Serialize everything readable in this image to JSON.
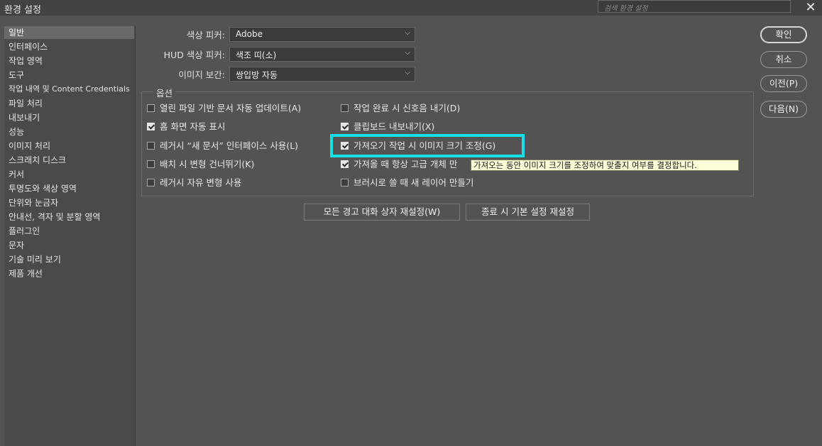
{
  "window": {
    "title": "환경 설정",
    "search_placeholder": "검색 환경 설정"
  },
  "sidebar": {
    "items": [
      "일반",
      "인터페이스",
      "작업 영역",
      "도구",
      "작업 내역 및 Content Credentials",
      "파일 처리",
      "내보내기",
      "성능",
      "이미지 처리",
      "스크래치 디스크",
      "커서",
      "투명도와 색상 영역",
      "단위와 눈금자",
      "안내선, 격자 및 분할 영역",
      "플러그인",
      "문자",
      "기술 미리 보기",
      "제품 개선"
    ]
  },
  "fields": {
    "color_picker": {
      "label": "색상 피커:",
      "value": "Adobe"
    },
    "hud_picker": {
      "label": "HUD 색상 피커:",
      "value": "색조 띠(소)"
    },
    "interpolation": {
      "label": "이미지 보간:",
      "value": "쌍입방 자동"
    }
  },
  "options": {
    "legend": "옵션",
    "items": [
      {
        "label": "열린 파일 기반 문서 자동 업데이트(A)",
        "checked": false
      },
      {
        "label": "작업 완료 시 신호음 내기(D)",
        "checked": false
      },
      {
        "label": "홈 화면 자동 표시",
        "checked": true
      },
      {
        "label": "클립보드 내보내기(X)",
        "checked": true
      },
      {
        "label": "레거시 “새 문서” 인터페이스 사용(L)",
        "checked": false
      },
      {
        "label": "가져오기 작업 시 이미지 크기 조정(G)",
        "checked": true
      },
      {
        "label": "배치 시 변형 건너뛰기(K)",
        "checked": false
      },
      {
        "label": "가져올 때 항상 고급 개체 만",
        "checked": true
      },
      {
        "label": "레거시 자유 변형 사용",
        "checked": false
      },
      {
        "label": "브러시로 쓸 때 새 레이어 만들기",
        "checked": false
      }
    ]
  },
  "tooltip": "가져오는 동안 이미지 크기를 조정하여 맞출지 여부를 결정합니다.",
  "buttons": {
    "reset_warnings": "모든 경고 대화 상자 재설정(W)",
    "reset_on_quit": "종료 시 기본 설정 재설정",
    "ok": "확인",
    "cancel": "취소",
    "prev": "이전(P)",
    "next": "다음(N)"
  },
  "colors": {
    "highlight": "#16e0e8",
    "tooltip_bg": "#fdfdd8",
    "background": "#535353"
  }
}
